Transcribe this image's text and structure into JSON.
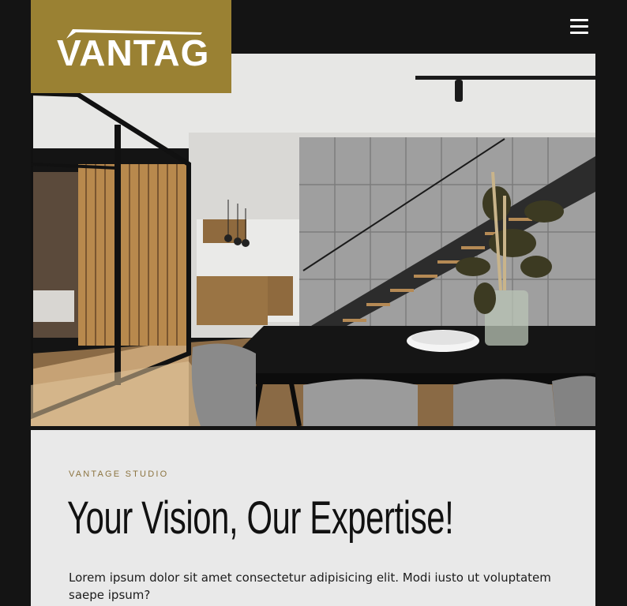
{
  "brand": {
    "logo_text": "VANTAGE",
    "logo_bg": "#9a8133"
  },
  "nav": {
    "menu_icon": "hamburger-menu-icon"
  },
  "hero": {
    "image_subject": "modern dining room interior with staircase"
  },
  "content": {
    "eyebrow": "VANTAGE STUDIO",
    "headline": "Your Vision, Our Expertise!",
    "body": "Lorem ipsum dolor sit amet consectetur adipisicing elit. Modi iusto ut voluptatem saepe ipsum?"
  },
  "colors": {
    "page_bg": "#141414",
    "accent": "#9a8133",
    "panel_bg": "#e9e9e9"
  }
}
